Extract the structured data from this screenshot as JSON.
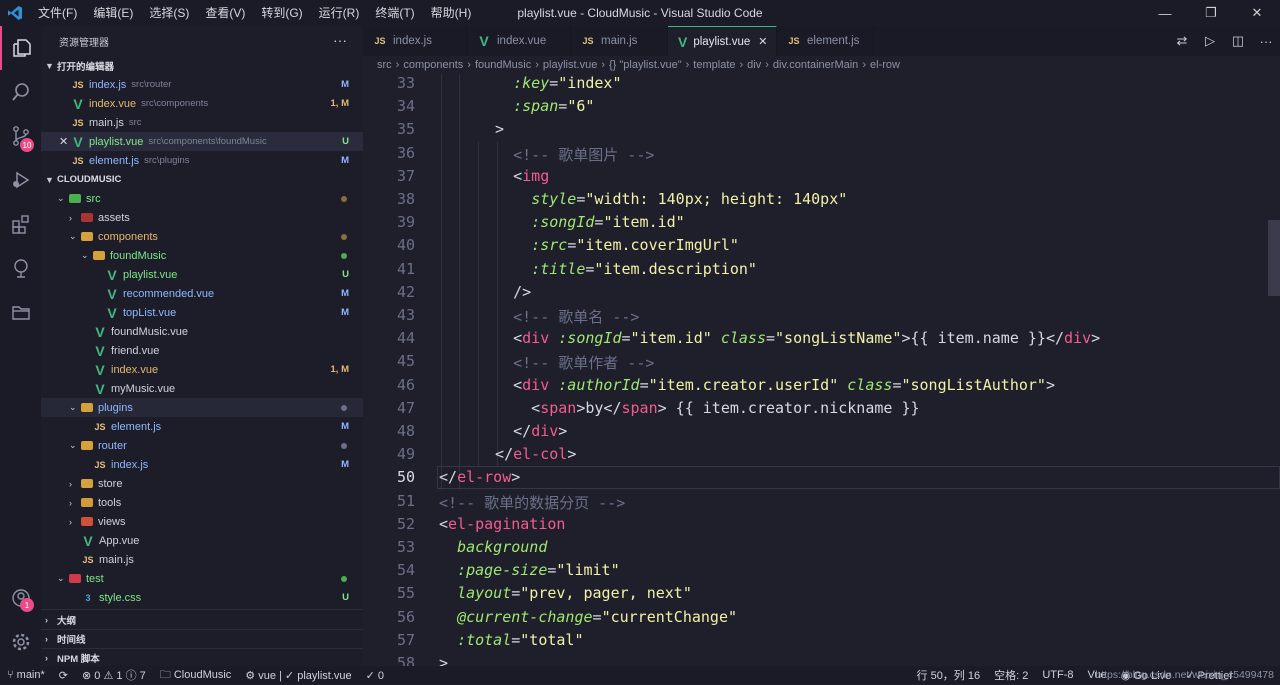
{
  "titlebar": {
    "menus": [
      "文件(F)",
      "编辑(E)",
      "选择(S)",
      "查看(V)",
      "转到(G)",
      "运行(R)",
      "终端(T)",
      "帮助(H)"
    ],
    "title": "playlist.vue - CloudMusic - Visual Studio Code"
  },
  "activity": {
    "scm_badge": "10",
    "accounts_badge": "1"
  },
  "sidebar": {
    "header": "资源管理器",
    "more": "···",
    "open_editors": "打开的编辑器",
    "project": "CLOUDMUSIC",
    "outline": "大纲",
    "timeline": "时间线",
    "npm": "NPM 脚本",
    "open_files": [
      {
        "icon": "JS",
        "name": "index.js",
        "path": "src\\router",
        "status": "M"
      },
      {
        "icon": "V",
        "name": "index.vue",
        "path": "src\\components",
        "status": "1, M"
      },
      {
        "icon": "JS",
        "name": "main.js",
        "path": "src",
        "status": ""
      },
      {
        "icon": "V",
        "name": "playlist.vue",
        "path": "src\\components\\foundMusic",
        "status": "U",
        "close": "✕"
      },
      {
        "icon": "JS",
        "name": "element.js",
        "path": "src\\plugins",
        "status": "M"
      }
    ],
    "tree": [
      {
        "label": "src",
        "status": ""
      },
      {
        "label": "assets",
        "status": ""
      },
      {
        "label": "components",
        "status": ""
      },
      {
        "label": "foundMusic",
        "status": ""
      },
      {
        "label": "playlist.vue",
        "status": "U"
      },
      {
        "label": "recommended.vue",
        "status": "M"
      },
      {
        "label": "topList.vue",
        "status": "M"
      },
      {
        "label": "foundMusic.vue",
        "status": ""
      },
      {
        "label": "friend.vue",
        "status": ""
      },
      {
        "label": "index.vue",
        "status": "1, M"
      },
      {
        "label": "myMusic.vue",
        "status": ""
      },
      {
        "label": "plugins",
        "status": ""
      },
      {
        "label": "element.js",
        "status": "M"
      },
      {
        "label": "router",
        "status": ""
      },
      {
        "label": "index.js",
        "status": "M"
      },
      {
        "label": "store",
        "status": ""
      },
      {
        "label": "tools",
        "status": ""
      },
      {
        "label": "views",
        "status": ""
      },
      {
        "label": "App.vue",
        "status": ""
      },
      {
        "label": "main.js",
        "status": ""
      },
      {
        "label": "test",
        "status": ""
      },
      {
        "label": "style.css",
        "status": "U"
      }
    ]
  },
  "editor": {
    "tabs": [
      {
        "icon": "JS",
        "label": "index.js"
      },
      {
        "icon": "V",
        "label": "index.vue"
      },
      {
        "icon": "JS",
        "label": "main.js"
      },
      {
        "icon": "V",
        "label": "playlist.vue",
        "close": "✕"
      },
      {
        "icon": "JS",
        "label": "element.js"
      }
    ],
    "breadcrumbs": [
      "src",
      "components",
      "foundMusic",
      "playlist.vue",
      "{} \"playlist.vue\"",
      "template",
      "div",
      "div.containerMain",
      "el-row"
    ],
    "line_numbers": [
      "33",
      "34",
      "35",
      "36",
      "37",
      "38",
      "39",
      "40",
      "41",
      "42",
      "43",
      "44",
      "45",
      "46",
      "47",
      "48",
      "49",
      "50",
      "51",
      "52",
      "53",
      "54",
      "55",
      "56",
      "57",
      "58"
    ],
    "lines": [
      [
        [
          "    ",
          "pu"
        ],
        [
          ":key",
          "at"
        ],
        [
          "=",
          "pu"
        ],
        [
          "\"index\"",
          "st"
        ]
      ],
      [
        [
          "    ",
          "pu"
        ],
        [
          ":span",
          "at"
        ],
        [
          "=",
          "pu"
        ],
        [
          "\"6\"",
          "st"
        ]
      ],
      [
        [
          "  >",
          "pu"
        ]
      ],
      [
        [
          "    ",
          "pu"
        ],
        [
          "<!-- 歌单图片 -->",
          "cm"
        ]
      ],
      [
        [
          "    <",
          "pu"
        ],
        [
          "img",
          "tg"
        ]
      ],
      [
        [
          "      ",
          "pu"
        ],
        [
          "style",
          "at"
        ],
        [
          "=",
          "pu"
        ],
        [
          "\"width: 140px; height: 140px\"",
          "st"
        ]
      ],
      [
        [
          "      ",
          "pu"
        ],
        [
          ":songId",
          "at"
        ],
        [
          "=",
          "pu"
        ],
        [
          "\"item.id\"",
          "st"
        ]
      ],
      [
        [
          "      ",
          "pu"
        ],
        [
          ":src",
          "at"
        ],
        [
          "=",
          "pu"
        ],
        [
          "\"item.coverImgUrl\"",
          "st"
        ]
      ],
      [
        [
          "      ",
          "pu"
        ],
        [
          ":title",
          "at"
        ],
        [
          "=",
          "pu"
        ],
        [
          "\"item.description\"",
          "st"
        ]
      ],
      [
        [
          "    />",
          "pu"
        ]
      ],
      [
        [
          "    ",
          "pu"
        ],
        [
          "<!-- 歌单名 -->",
          "cm"
        ]
      ],
      [
        [
          "    <",
          "pu"
        ],
        [
          "div",
          "tg"
        ],
        [
          " ",
          "pu"
        ],
        [
          ":songId",
          "at"
        ],
        [
          "=",
          "pu"
        ],
        [
          "\"item.id\"",
          "st"
        ],
        [
          " ",
          "pu"
        ],
        [
          "class",
          "at"
        ],
        [
          "=",
          "pu"
        ],
        [
          "\"songListName\"",
          "st"
        ],
        [
          ">{{ item.name }}</",
          "pu"
        ],
        [
          "div",
          "tg"
        ],
        [
          ">",
          "pu"
        ]
      ],
      [
        [
          "    ",
          "pu"
        ],
        [
          "<!-- 歌单作者 -->",
          "cm"
        ]
      ],
      [
        [
          "    <",
          "pu"
        ],
        [
          "div",
          "tg"
        ],
        [
          " ",
          "pu"
        ],
        [
          ":authorId",
          "at"
        ],
        [
          "=",
          "pu"
        ],
        [
          "\"item.creator.userId\"",
          "st"
        ],
        [
          " ",
          "pu"
        ],
        [
          "class",
          "at"
        ],
        [
          "=",
          "pu"
        ],
        [
          "\"songListAuthor\"",
          "st"
        ],
        [
          ">",
          "pu"
        ]
      ],
      [
        [
          "      <",
          "pu"
        ],
        [
          "span",
          "tg"
        ],
        [
          ">by</",
          "pu"
        ],
        [
          "span",
          "tg"
        ],
        [
          "> {{ item.creator.nickname }}",
          "pu"
        ]
      ],
      [
        [
          "    </",
          "pu"
        ],
        [
          "div",
          "tg"
        ],
        [
          ">",
          "pu"
        ]
      ],
      [
        [
          "  </",
          "pu"
        ],
        [
          "el-col",
          "tg"
        ],
        [
          ">",
          "pu"
        ]
      ],
      [
        [
          "</",
          "pu"
        ],
        [
          "el-row",
          "tg"
        ],
        [
          ">",
          "pu"
        ]
      ],
      [
        [
          "",
          "pu"
        ],
        [
          "<!-- 歌单的数据分页 -->",
          "cm"
        ]
      ],
      [
        [
          "<",
          "pu"
        ],
        [
          "el-pagination",
          "tg"
        ]
      ],
      [
        [
          "  ",
          "pu"
        ],
        [
          "background",
          "at"
        ]
      ],
      [
        [
          "  ",
          "pu"
        ],
        [
          ":page-size",
          "at"
        ],
        [
          "=",
          "pu"
        ],
        [
          "\"limit\"",
          "st"
        ]
      ],
      [
        [
          "  ",
          "pu"
        ],
        [
          "layout",
          "at"
        ],
        [
          "=",
          "pu"
        ],
        [
          "\"prev, pager, next\"",
          "st"
        ]
      ],
      [
        [
          "  ",
          "pu"
        ],
        [
          "@current-change",
          "at"
        ],
        [
          "=",
          "pu"
        ],
        [
          "\"currentChange\"",
          "st"
        ]
      ],
      [
        [
          "  ",
          "pu"
        ],
        [
          ":total",
          "at"
        ],
        [
          "=",
          "pu"
        ],
        [
          "\"total\"",
          "st"
        ]
      ],
      [
        [
          ">",
          "pu"
        ]
      ]
    ]
  },
  "statusbar": {
    "branch": "main*",
    "errors": "0",
    "warnings": "1",
    "info": "7",
    "folder": "CloudMusic",
    "vetur": "vue | ✓ playlist.vue",
    "check": "✓ 0",
    "position": "行 50，列 16",
    "spaces": "空格: 2",
    "encoding": "UTF-8",
    "language": "Vue",
    "live": "Go Live",
    "prettier": "✓ Prettier",
    "watermark": "https://blog.csdn.net/weixin_45499478"
  }
}
